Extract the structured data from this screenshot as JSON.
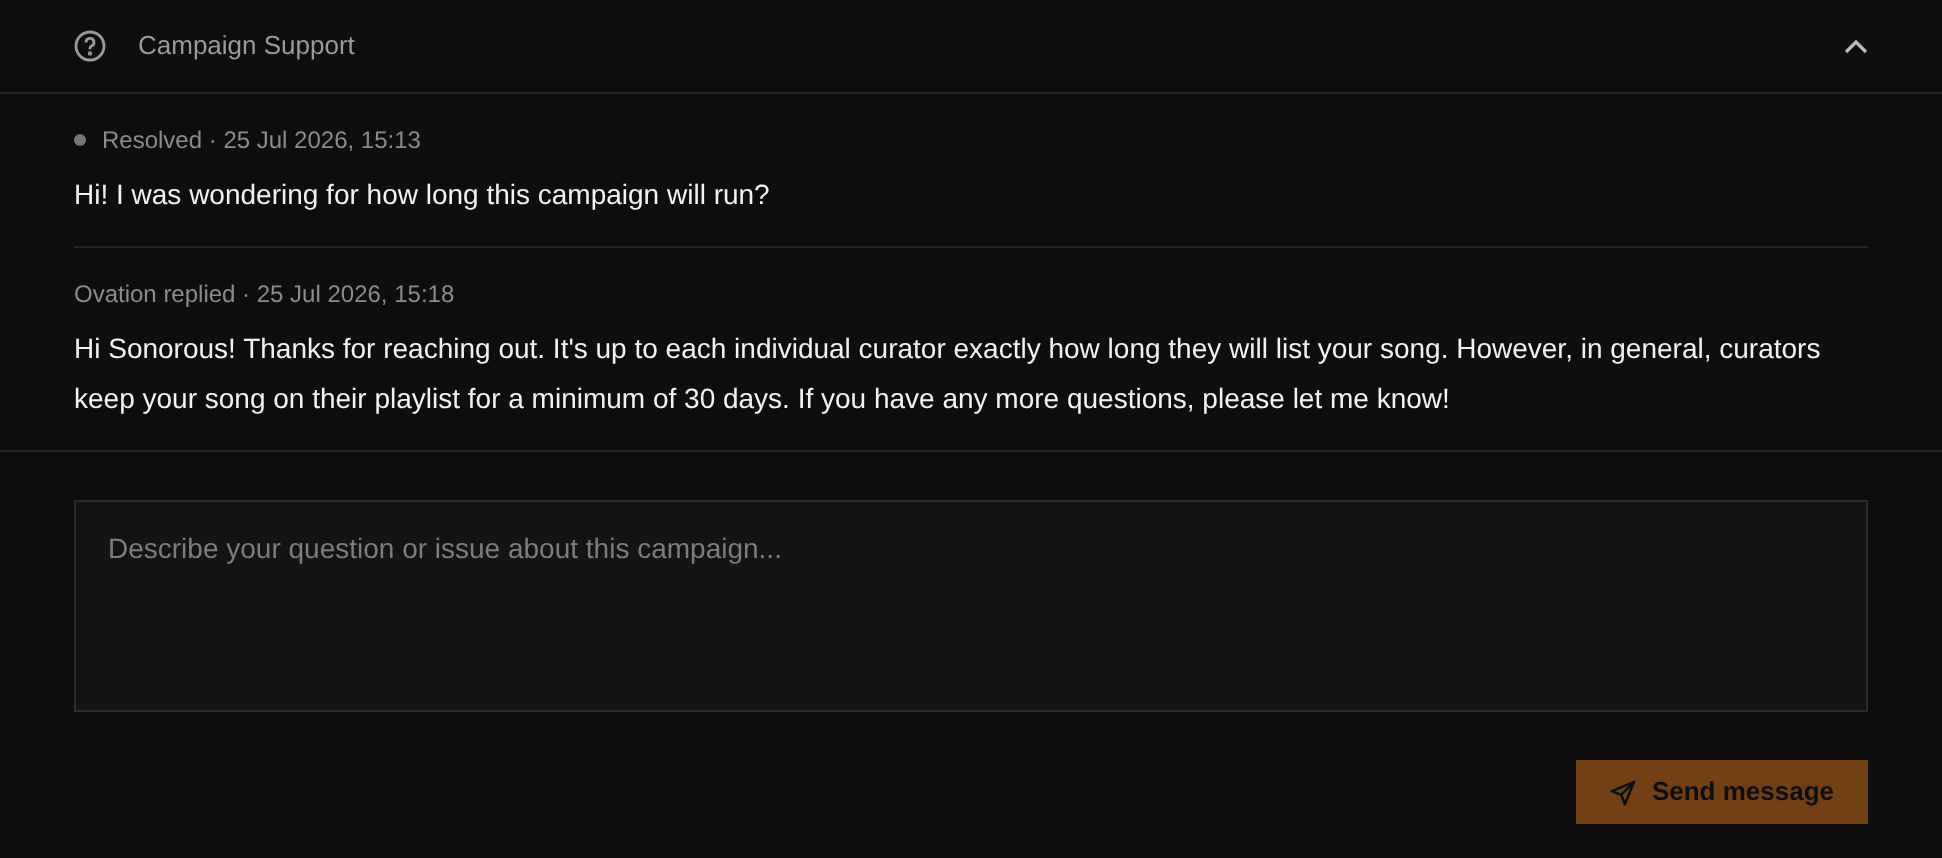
{
  "header": {
    "title": "Campaign Support",
    "expanded": true
  },
  "messages": [
    {
      "kind": "status",
      "meta": "Resolved · 25 Jul 2026, 15:13",
      "text": "Hi! I was wondering for how long this campaign will run?"
    },
    {
      "kind": "reply",
      "meta": "Ovation replied · 25 Jul 2026, 15:18",
      "text": "Hi Sonorous! Thanks for reaching out. It's up to each individual curator exactly how long they will list your song. However, in general, curators keep your song on their playlist for a minimum of 30 days. If you have any more questions, please let me know!"
    }
  ],
  "composer": {
    "placeholder": "Describe your question or issue about this campaign..."
  },
  "send_button": {
    "label": "Send message",
    "disabled": true
  }
}
